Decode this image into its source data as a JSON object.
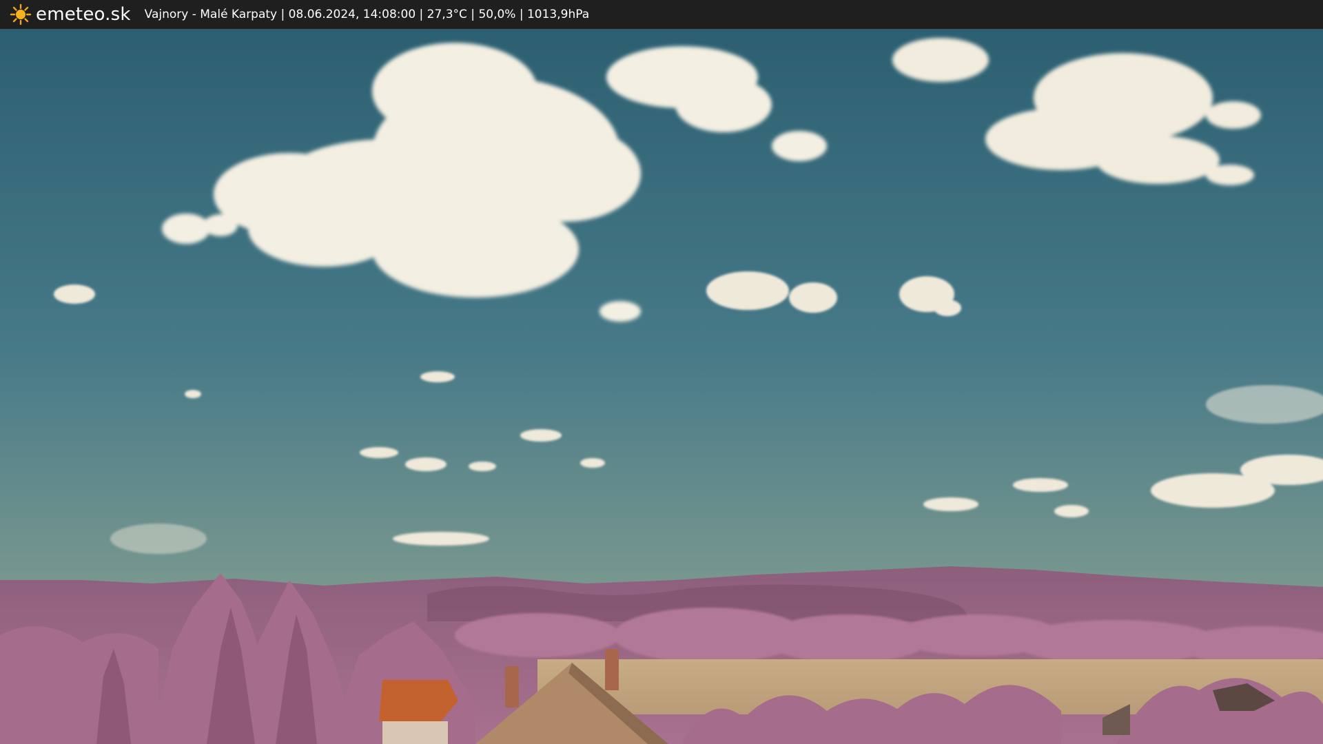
{
  "header": {
    "brand": "emeteo.sk",
    "info_line": "Vajnory - Malé Karpaty | 08.06.2024, 14:08:00 | 27,3°C | 50,0% | 1013,9hPa",
    "logo_icon": "sun-icon"
  },
  "scene": {
    "description_icon": "webcam-image",
    "colors": {
      "sky_top": "#2f6273",
      "sky_mid": "#4e7d89",
      "sky_horizon": "#8ea39a",
      "cloud": "#f3efe3",
      "hills": "#9a6a86",
      "trees": "#b77c9d",
      "field": "#c9ad85",
      "roof": "#c2622f"
    }
  }
}
